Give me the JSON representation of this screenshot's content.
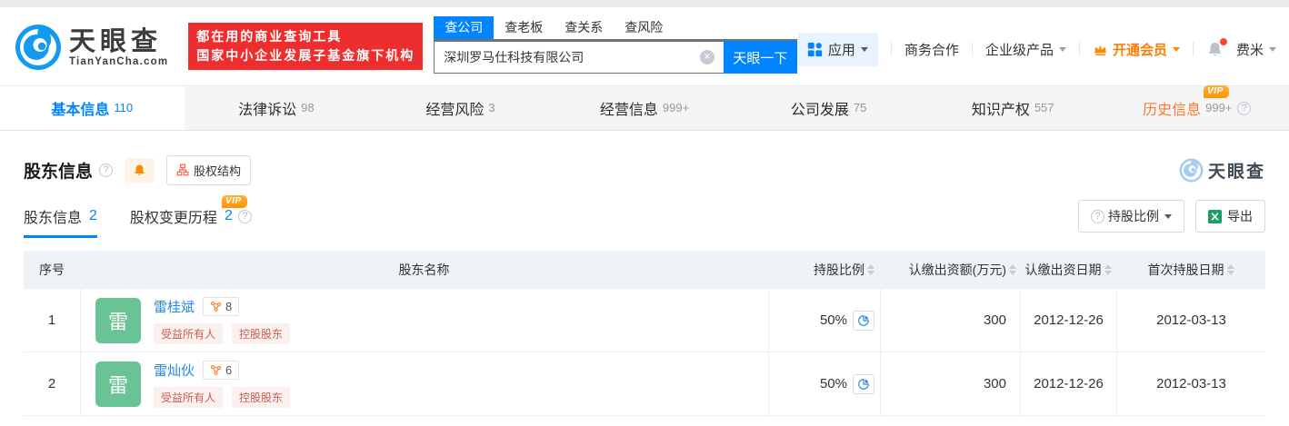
{
  "badges": {
    "vip": "VIP"
  },
  "header": {
    "logo": {
      "title": "天眼查",
      "subtitle": "TianYanCha.com"
    },
    "slogan": {
      "line1": "都在用的商业查询工具",
      "line2": "国家中小企业发展子基金旗下机构"
    },
    "search": {
      "tabs": [
        {
          "label": "查公司",
          "active": true
        },
        {
          "label": "查老板"
        },
        {
          "label": "查关系"
        },
        {
          "label": "查风险"
        }
      ],
      "value": "深圳罗马仕科技有限公司",
      "button": "天眼一下"
    },
    "nav": {
      "apps": "应用",
      "cooperation": "商务合作",
      "enterprise": "企业级产品",
      "vip": "开通会员",
      "user": "费米"
    }
  },
  "tabbar": {
    "tabs": [
      {
        "label": "基本信息",
        "count": "110",
        "active": true
      },
      {
        "label": "法律诉讼",
        "count": "98"
      },
      {
        "label": "经营风险",
        "count": "3"
      },
      {
        "label": "经营信息",
        "count": "999+"
      },
      {
        "label": "公司发展",
        "count": "75"
      },
      {
        "label": "知识产权",
        "count": "557"
      },
      {
        "label": "历史信息",
        "count": "999+",
        "vip": true,
        "help": true
      }
    ]
  },
  "section": {
    "title": "股东信息",
    "structure_button": "股权结构",
    "watermark": "天眼查",
    "subtabs": [
      {
        "label": "股东信息",
        "count": "2",
        "active": true
      },
      {
        "label": "股权变更历程",
        "count": "2",
        "vip": true,
        "help": true
      }
    ],
    "ratio_button": "持股比例",
    "export_button": "导出"
  },
  "table": {
    "columns": [
      "序号",
      "股东名称",
      "持股比例",
      "认缴出资额(万元)",
      "认缴出资日期",
      "首次持股日期"
    ],
    "rows": [
      {
        "index": "1",
        "avatar": "雷",
        "name": "雷桂斌",
        "relation_count": "8",
        "tags": [
          "受益所有人",
          "控股股东"
        ],
        "ratio": "50%",
        "amount": "300",
        "subscribe_date": "2012-12-26",
        "first_date": "2012-03-13"
      },
      {
        "index": "2",
        "avatar": "雷",
        "name": "雷灿伙",
        "relation_count": "6",
        "tags": [
          "受益所有人",
          "控股股东"
        ],
        "ratio": "50%",
        "amount": "300",
        "subscribe_date": "2012-12-26",
        "first_date": "2012-03-13"
      }
    ]
  },
  "colors": {
    "primary_blue": "#0084ff",
    "vip_orange": "#ff8a00",
    "slogan_red": "#ee2e2e",
    "tag_red": "#c75d50",
    "avatar_green": "#69c394",
    "excel_green": "#1f9e63"
  }
}
